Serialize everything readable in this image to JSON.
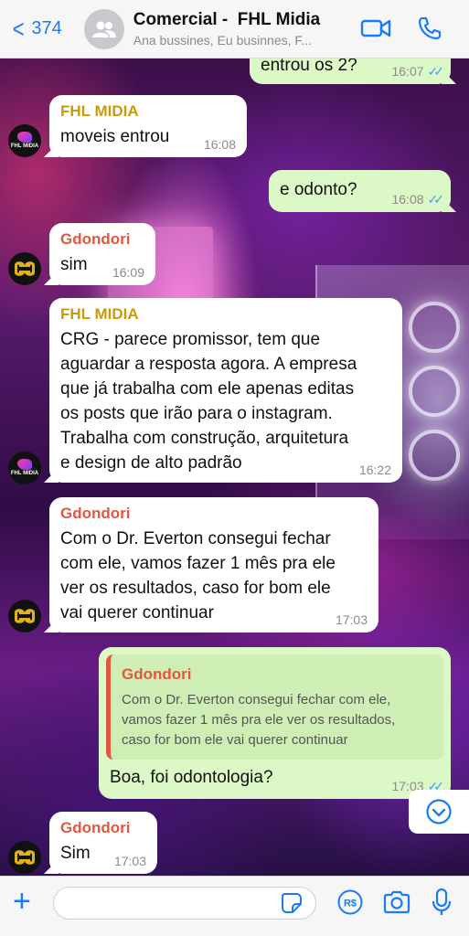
{
  "header": {
    "back_count": "374",
    "title": "Comercial -  FHL Midia",
    "subtitle": "Ana bussines, Eu businnes, F..."
  },
  "messages": [
    {
      "id": "m1",
      "direction": "out",
      "text": "entrou os 2?",
      "time": "16:07",
      "ticks": "✓✓"
    },
    {
      "id": "m2",
      "direction": "in",
      "sender": "FHL MIDIA",
      "text": "moveis entrou",
      "time": "16:08"
    },
    {
      "id": "m3",
      "direction": "out",
      "text": "e odonto?",
      "time": "16:08",
      "ticks": "✓✓"
    },
    {
      "id": "m4",
      "direction": "in",
      "sender": "Gdondori",
      "text": "sim",
      "time": "16:09"
    },
    {
      "id": "m5",
      "direction": "in",
      "sender": "FHL MIDIA",
      "lines": [
        "CRG - parece promissor, tem que",
        "aguardar a resposta agora. A empresa",
        "que já trabalha com ele apenas editas",
        "os posts que irão para o instagram.",
        "Trabalha com construção, arquitetura",
        "e design de alto padrão"
      ],
      "time": "16:22"
    },
    {
      "id": "m6",
      "direction": "in",
      "sender": "Gdondori",
      "lines": [
        "Com o Dr. Everton consegui fechar",
        "com ele, vamos fazer 1 mês pra ele",
        "ver os resultados, caso for bom ele",
        "vai querer continuar"
      ],
      "time": "17:03"
    },
    {
      "id": "m7",
      "direction": "out",
      "quote_author": "Gdondori",
      "quote_lines": [
        "Com o Dr. Everton consegui fechar com ele,",
        "vamos fazer 1 mês pra ele ver os resultados,",
        "caso for bom ele vai querer continuar"
      ],
      "text": "Boa, foi odontologia?",
      "time": "17:03",
      "ticks": "✓✓"
    },
    {
      "id": "m8",
      "direction": "in",
      "sender": "Gdondori",
      "text": "Sim",
      "time": "17:03"
    }
  ],
  "avatars": {
    "fhl_label": "FHL MIDIA"
  },
  "input": {
    "placeholder": ""
  },
  "colors": {
    "accent": "#1a7cf5",
    "outgoing_bubble": "#dcf8c6",
    "sender_fhl": "#c99a0a",
    "sender_gdondori": "#e2583e",
    "read_ticks": "#47a0f0"
  },
  "icons": [
    "back-chevron-icon",
    "group-avatar-icon",
    "video-call-icon",
    "phone-icon",
    "plus-icon",
    "sticker-icon",
    "payment-icon",
    "camera-icon",
    "microphone-icon",
    "scroll-down-icon"
  ]
}
